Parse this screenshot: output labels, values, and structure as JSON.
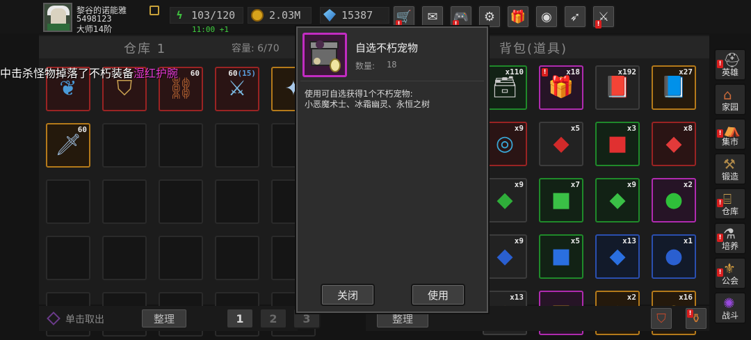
{
  "player": {
    "name": "黎谷的诺能雅",
    "id": "5498123",
    "rank": "大师14阶"
  },
  "resources": {
    "energy": "103/120",
    "energy_timer": "11:00 +1",
    "gold": "2.03M",
    "gems": "15387"
  },
  "top_buttons": [
    {
      "name": "shop",
      "icon": "cart-icon",
      "glyph": "🛒",
      "badge": "!"
    },
    {
      "name": "mail",
      "icon": "mail-icon",
      "glyph": "✉",
      "badge": ""
    },
    {
      "name": "gamepad",
      "icon": "gamepad-icon",
      "glyph": "🎮",
      "badge": "!"
    },
    {
      "name": "settings",
      "icon": "gear-icon",
      "glyph": "⚙",
      "badge": ""
    },
    {
      "name": "gift",
      "icon": "gift-icon",
      "glyph": "🎁",
      "badge": ""
    },
    {
      "name": "wheel",
      "icon": "wheel-icon",
      "glyph": "◉",
      "badge": ""
    },
    {
      "name": "feather",
      "icon": "feather-icon",
      "glyph": "➶",
      "badge": ""
    },
    {
      "name": "swords",
      "icon": "crossed-swords-icon",
      "glyph": "⚔",
      "badge": "!"
    }
  ],
  "warehouse": {
    "title": "仓库 1",
    "capacity": "容量: 6/70",
    "slots": [
      {
        "count": "",
        "rarity": "red",
        "icon": "wing-icon",
        "glyph": "❦"
      },
      {
        "count": "",
        "rarity": "red",
        "icon": "armor-icon",
        "glyph": "⛉"
      },
      {
        "count": "60",
        "rarity": "red",
        "icon": "bracer-icon",
        "glyph": "⛓"
      },
      {
        "count": "60",
        "count_extra": "(15)",
        "rarity": "red",
        "icon": "blade-icon",
        "glyph": "⚔"
      },
      {
        "count": "",
        "rarity": "orange",
        "icon": "staff-icon",
        "glyph": "✦"
      },
      {
        "count": "60",
        "rarity": "orange",
        "icon": "sword-icon",
        "glyph": "🗡"
      }
    ],
    "unclick_label": "单击取出",
    "sort_label": "整理",
    "pages": [
      "1",
      "2",
      "3"
    ]
  },
  "bag": {
    "title": "背包(道具)",
    "sort_label": "整理",
    "slots": [
      {
        "count": "x110",
        "rarity": "green",
        "icon": "chest-icon",
        "glyph": "🗃",
        "badge": ""
      },
      {
        "count": "x18",
        "rarity": "pink",
        "icon": "pet-box-icon",
        "glyph": "🎁",
        "badge": "!"
      },
      {
        "count": "x192",
        "rarity": "plain",
        "icon": "book-icon",
        "glyph": "📕",
        "badge": ""
      },
      {
        "count": "x27",
        "rarity": "orange",
        "icon": "tome-icon",
        "glyph": "📘",
        "badge": ""
      },
      {
        "count": "x9",
        "rarity": "red",
        "icon": "orb-icon",
        "glyph": "◎",
        "badge": ""
      },
      {
        "count": "x5",
        "rarity": "plain",
        "icon": "red-gem-icon",
        "glyph": "◆",
        "badge": ""
      },
      {
        "count": "x3",
        "rarity": "green",
        "icon": "red-cube-icon",
        "glyph": "■",
        "badge": ""
      },
      {
        "count": "x8",
        "rarity": "red",
        "icon": "red-diamond-icon",
        "glyph": "◆",
        "badge": ""
      },
      {
        "count": "x9",
        "rarity": "plain",
        "icon": "green-gem-icon",
        "glyph": "◆",
        "badge": ""
      },
      {
        "count": "x7",
        "rarity": "green",
        "icon": "green-cube-icon",
        "glyph": "■",
        "badge": ""
      },
      {
        "count": "x9",
        "rarity": "green",
        "icon": "green-diamond-icon",
        "glyph": "◆",
        "badge": ""
      },
      {
        "count": "x2",
        "rarity": "pink",
        "icon": "green-orb-icon",
        "glyph": "●",
        "badge": ""
      },
      {
        "count": "x9",
        "rarity": "plain",
        "icon": "blue-gem-icon",
        "glyph": "◆",
        "badge": ""
      },
      {
        "count": "x5",
        "rarity": "green",
        "icon": "blue-cube-icon",
        "glyph": "■",
        "badge": ""
      },
      {
        "count": "x13",
        "rarity": "blue",
        "icon": "blue-diamond-icon",
        "glyph": "◆",
        "badge": ""
      },
      {
        "count": "x1",
        "rarity": "blue",
        "icon": "blue-orb-icon",
        "glyph": "●",
        "badge": ""
      },
      {
        "count": "x13",
        "rarity": "plain",
        "icon": "gold-gem-icon",
        "glyph": "◆",
        "badge": ""
      },
      {
        "count": "",
        "rarity": "pink",
        "icon": "gold-cube-icon",
        "glyph": "■",
        "badge": ""
      },
      {
        "count": "x2",
        "rarity": "orange",
        "icon": "gold-diamond-icon",
        "glyph": "◆",
        "badge": ""
      },
      {
        "count": "x16",
        "rarity": "orange",
        "icon": "gold-orb-icon",
        "glyph": "●",
        "badge": ""
      }
    ]
  },
  "side_nav": [
    {
      "label": "英雄",
      "icon": "helmet-icon",
      "glyph": "⛑",
      "badge": "!"
    },
    {
      "label": "家园",
      "icon": "house-icon",
      "glyph": "⌂",
      "badge": ""
    },
    {
      "label": "集市",
      "icon": "market-icon",
      "glyph": "⛺",
      "badge": "!"
    },
    {
      "label": "锻造",
      "icon": "anvil-icon",
      "glyph": "⚒",
      "badge": ""
    },
    {
      "label": "仓库",
      "icon": "warehouse-icon",
      "glyph": "⌸",
      "badge": "!"
    },
    {
      "label": "培养",
      "icon": "training-icon",
      "glyph": "⚗",
      "badge": "!"
    },
    {
      "label": "公会",
      "icon": "guild-icon",
      "glyph": "⚜",
      "badge": "!"
    },
    {
      "label": "战斗",
      "icon": "portal-icon",
      "glyph": "✺",
      "badge": ""
    }
  ],
  "bottom_right_icons": [
    {
      "icon": "armor-icon",
      "glyph": "⛉",
      "badge": ""
    },
    {
      "icon": "potion-icon",
      "glyph": "⚱",
      "badge": "!"
    }
  ],
  "notice": {
    "text": "中击杀怪物掉落了不朽装备",
    "highlight": "湿红护腕"
  },
  "modal": {
    "title": "自选不朽宠物",
    "qty_label": "数量:",
    "qty_value": "18",
    "desc_line1": "使用可自选获得1个不朽宠物:",
    "desc_line2": "小恶魔术士、冰霜幽灵、永恒之树",
    "close_label": "关闭",
    "use_label": "使用"
  },
  "colors": {
    "red": "#9a2323",
    "orange": "#b57a1a",
    "green": "#1f8a2a",
    "pink": "#b02bb0",
    "blue": "#2a4fb0",
    "accent_green": "#3fcf3f",
    "notice_highlight": "#e23ad0"
  }
}
